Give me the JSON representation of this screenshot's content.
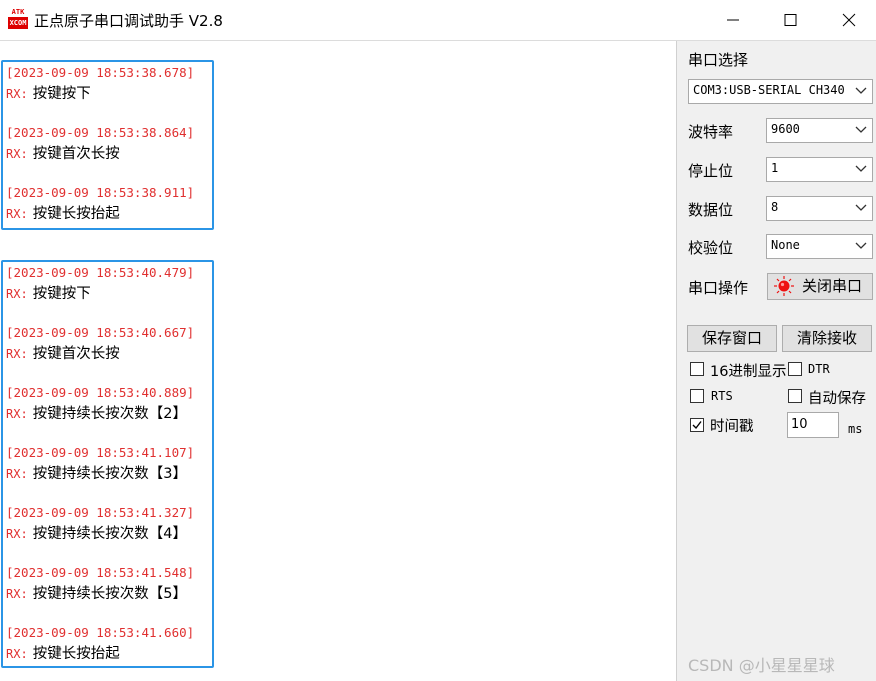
{
  "window": {
    "title": "正点原子串口调试助手 V2.8",
    "icon_top_text": "ATK",
    "icon_bottom_text": "XCOM"
  },
  "receive": {
    "rx_tag": "RX:",
    "groups": [
      {
        "entries": [
          {
            "timestamp": "[2023-09-09 18:53:38.678]",
            "message": "按键按下"
          },
          {
            "timestamp": "[2023-09-09 18:53:38.864]",
            "message": "按键首次长按"
          },
          {
            "timestamp": "[2023-09-09 18:53:38.911]",
            "message": "按键长按抬起"
          }
        ]
      },
      {
        "entries": [
          {
            "timestamp": "[2023-09-09 18:53:40.479]",
            "message": "按键按下"
          },
          {
            "timestamp": "[2023-09-09 18:53:40.667]",
            "message": "按键首次长按"
          },
          {
            "timestamp": "[2023-09-09 18:53:40.889]",
            "message": "按键持续长按次数【2】"
          },
          {
            "timestamp": "[2023-09-09 18:53:41.107]",
            "message": "按键持续长按次数【3】"
          },
          {
            "timestamp": "[2023-09-09 18:53:41.327]",
            "message": "按键持续长按次数【4】"
          },
          {
            "timestamp": "[2023-09-09 18:53:41.548]",
            "message": "按键持续长按次数【5】"
          },
          {
            "timestamp": "[2023-09-09 18:53:41.660]",
            "message": "按键长按抬起"
          }
        ]
      }
    ]
  },
  "panel": {
    "port_select_label": "串口选择",
    "port_value": "COM3:USB-SERIAL CH340",
    "baud_label": "波特率",
    "baud_value": "9600",
    "stopbits_label": "停止位",
    "stopbits_value": "1",
    "databits_label": "数据位",
    "databits_value": "8",
    "parity_label": "校验位",
    "parity_value": "None",
    "port_op_label": "串口操作",
    "close_port_label": "关闭串口",
    "save_window_label": "保存窗口",
    "clear_receive_label": "清除接收",
    "hex_display_label": "16进制显示",
    "dtr_label": "DTR",
    "rts_label": "RTS",
    "auto_save_label": "自动保存",
    "timestamp_label": "时间戳",
    "timestamp_checked": true,
    "timestamp_value": "10",
    "ms_label": "ms"
  },
  "watermark": "CSDN @小星星星球",
  "colors": {
    "timestamp_red": "#e03030",
    "group_border_blue": "#2b95e6",
    "status_led_red": "#ee1111"
  }
}
